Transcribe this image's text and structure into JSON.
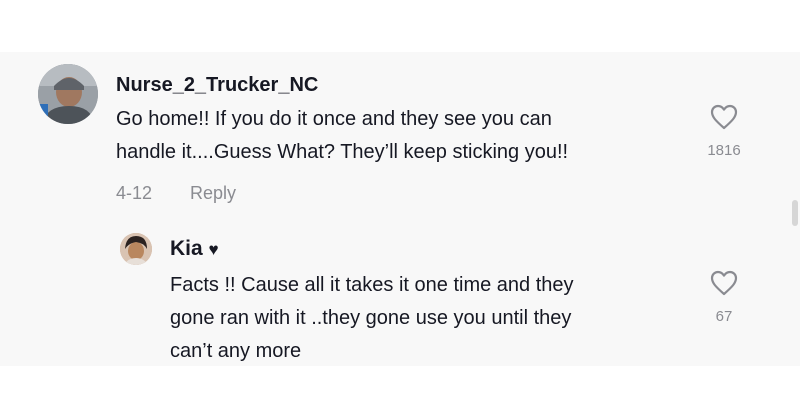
{
  "comment": {
    "username": "Nurse_2_Trucker_NC",
    "text_line_1": "Go home!! If you do it once and they see you can",
    "text_line_2": "handle it....Guess What? They’ll keep sticking you!!",
    "date": "4-12",
    "reply_label": "Reply",
    "like_count": "1816",
    "like_icon": "heart-outline-icon"
  },
  "reply": {
    "username": "Kia",
    "username_suffix": "♥",
    "text_line_1": "Facts !! Cause all it takes it one time and they",
    "text_line_2": "gone ran with it ..they gone use you until they",
    "text_line_3": "can’t any more",
    "like_count": "67",
    "like_icon": "heart-outline-icon"
  },
  "colors": {
    "panel_background": "#f8f8f8",
    "text_primary": "#161823",
    "text_secondary": "#8a8b91"
  }
}
